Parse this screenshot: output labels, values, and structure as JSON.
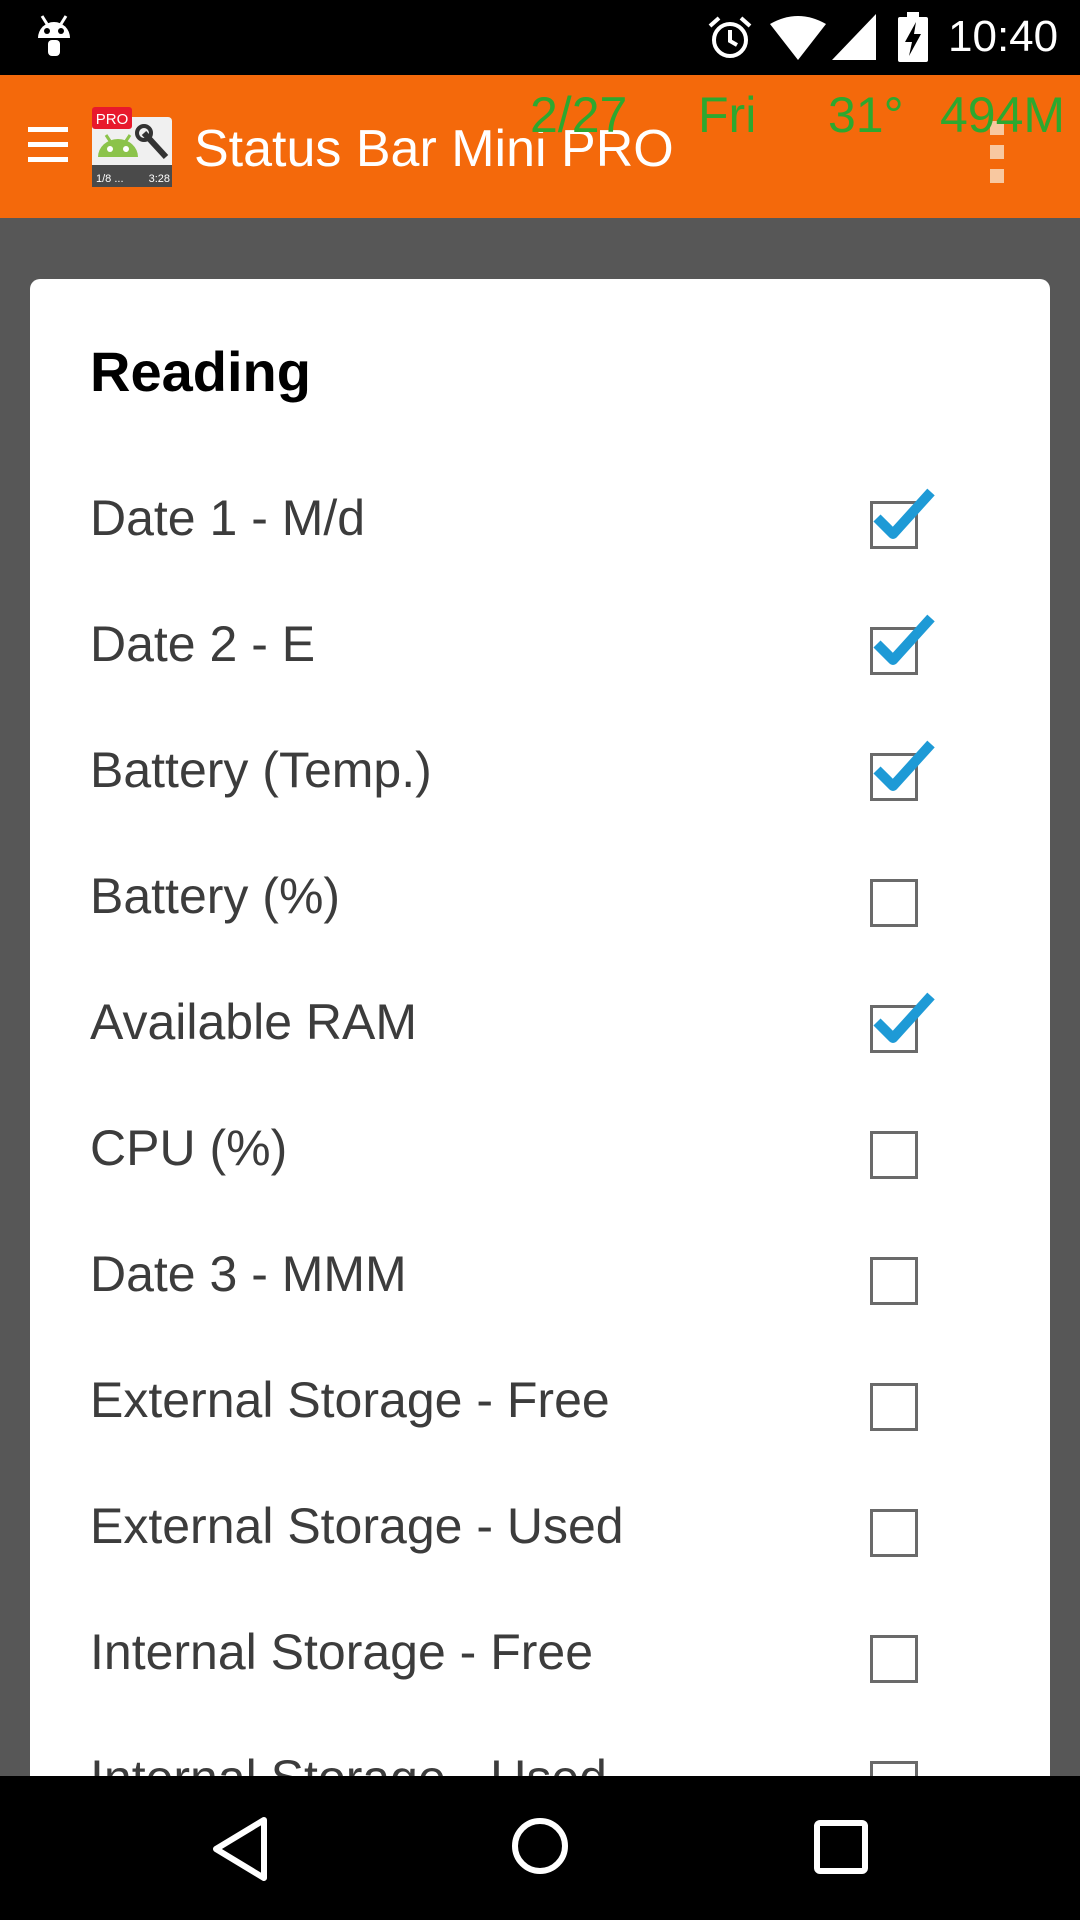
{
  "status_bar": {
    "time": "10:40",
    "icons": [
      "android-debug-icon",
      "alarm-icon",
      "wifi-icon",
      "signal-icon",
      "battery-charging-icon"
    ]
  },
  "app_bar": {
    "title": "Status Bar Mini PRO",
    "logo_badge": "PRO",
    "logo_caption_left": "1/8 ...",
    "logo_caption_right": "3:28",
    "accent_color": "#f4690b",
    "preview": {
      "date1": "2/27",
      "date2": "Fri",
      "temp": "31°",
      "ram": "494M",
      "color": "#2da82f"
    }
  },
  "dialog": {
    "title": "Reading",
    "options": [
      {
        "label": "Date 1 - M/d",
        "checked": true
      },
      {
        "label": "Date 2 - E",
        "checked": true
      },
      {
        "label": "Battery (Temp.)",
        "checked": true
      },
      {
        "label": "Battery (%)",
        "checked": false
      },
      {
        "label": "Available RAM",
        "checked": true
      },
      {
        "label": "CPU (%)",
        "checked": false
      },
      {
        "label": "Date 3 - MMM",
        "checked": false
      },
      {
        "label": "External Storage - Free",
        "checked": false
      },
      {
        "label": "External Storage - Used",
        "checked": false
      },
      {
        "label": "Internal Storage - Free",
        "checked": false
      },
      {
        "label": "Internal Storage - Used",
        "checked": false
      }
    ],
    "check_color": "#1e9ad6"
  },
  "nav_bar": {
    "buttons": [
      "back-icon",
      "home-icon",
      "recents-icon"
    ]
  }
}
